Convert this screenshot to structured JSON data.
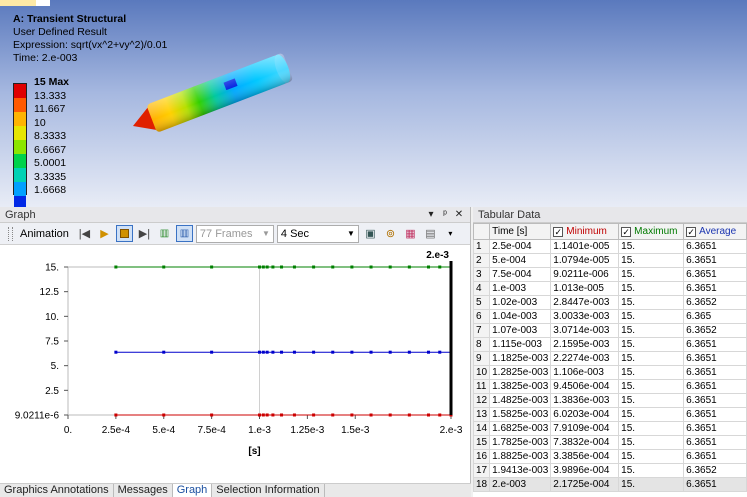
{
  "viewport": {
    "title": "A: Transient Structural",
    "subtitle": "User Defined Result",
    "expression": "Expression: sqrt(vx^2+vy^2)/0.01",
    "time": "Time: 2.e-003",
    "legend": [
      {
        "label": "15 Max",
        "color": "#e00000"
      },
      {
        "label": "13.333",
        "color": "#ff5a00"
      },
      {
        "label": "11.667",
        "color": "#ffb400"
      },
      {
        "label": "10",
        "color": "#e6e600"
      },
      {
        "label": "8.3333",
        "color": "#8ce600"
      },
      {
        "label": "6.6667",
        "color": "#00d24a"
      },
      {
        "label": "5.0001",
        "color": "#00d2b4"
      },
      {
        "label": "3.3335",
        "color": "#00a0ff"
      },
      {
        "label": "1.6668",
        "color": "#0028e6"
      }
    ]
  },
  "graph_panel": {
    "title": "Graph",
    "controls": [
      "▾",
      "ᵖ",
      "✕"
    ],
    "animation_label": "Animation",
    "frames_select": "77 Frames",
    "duration_select": "4 Sec"
  },
  "chart_data": {
    "type": "line",
    "xlabel": "[s]",
    "current_time_label": "2.e-3",
    "xlim": [
      0,
      0.002
    ],
    "ylim": [
      0,
      15
    ],
    "x_ticks": [
      "0.",
      "2.5e-4",
      "5.e-4",
      "7.5e-4",
      "1.e-3",
      "1.25e-3",
      "1.5e-3",
      "2.e-3"
    ],
    "x_tick_values": [
      0,
      0.00025,
      0.0005,
      0.00075,
      0.001,
      0.00125,
      0.0015,
      0.002
    ],
    "y_ticks": [
      "9.0211e-6",
      "2.5",
      "5.",
      "7.5",
      "10.",
      "12.5",
      "15."
    ],
    "y_tick_values": [
      0,
      2.5,
      5,
      7.5,
      10,
      12.5,
      15
    ],
    "x": [
      0.00025,
      0.0005,
      0.00075,
      0.001,
      0.00102,
      0.00104,
      0.00107,
      0.001115,
      0.0011825,
      0.0012825,
      0.0013825,
      0.0014825,
      0.0015825,
      0.0016825,
      0.0017825,
      0.0018825,
      0.0019413,
      0.002
    ],
    "series": [
      {
        "color": "#cc0000",
        "values": [
          1.1401e-05,
          1.0794e-05,
          9.0211e-06,
          1.013e-05,
          0.0028447,
          0.0030033,
          0.0030714,
          0.0021595,
          0.0022274,
          0.001106,
          0.00094506,
          0.0013836,
          0.00060203,
          0.00079109,
          0.00073832,
          0.00033856,
          0.00039896,
          0.00021725
        ]
      },
      {
        "color": "#008000",
        "values": [
          15,
          15,
          15,
          15,
          15,
          15,
          15,
          15,
          15,
          15,
          15,
          15,
          15,
          15,
          15,
          15,
          15,
          15
        ]
      },
      {
        "color": "#0000cc",
        "values": [
          6.3651,
          6.3651,
          6.3651,
          6.3651,
          6.3652,
          6.365,
          6.3652,
          6.3651,
          6.3651,
          6.3651,
          6.3651,
          6.3651,
          6.3651,
          6.3651,
          6.3651,
          6.3651,
          6.3652,
          6.3651
        ]
      }
    ],
    "step_labels": [
      "1",
      "2"
    ]
  },
  "table_panel": {
    "title": "Tabular Data",
    "headers": {
      "time": "Time [s]",
      "min": "Minimum",
      "max": "Maximum",
      "avg": "Average"
    },
    "rows": [
      [
        "1",
        "2.5e-004",
        "1.1401e-005",
        "15.",
        "6.3651"
      ],
      [
        "2",
        "5.e-004",
        "1.0794e-005",
        "15.",
        "6.3651"
      ],
      [
        "3",
        "7.5e-004",
        "9.0211e-006",
        "15.",
        "6.3651"
      ],
      [
        "4",
        "1.e-003",
        "1.013e-005",
        "15.",
        "6.3651"
      ],
      [
        "5",
        "1.02e-003",
        "2.8447e-003",
        "15.",
        "6.3652"
      ],
      [
        "6",
        "1.04e-003",
        "3.0033e-003",
        "15.",
        "6.365"
      ],
      [
        "7",
        "1.07e-003",
        "3.0714e-003",
        "15.",
        "6.3652"
      ],
      [
        "8",
        "1.115e-003",
        "2.1595e-003",
        "15.",
        "6.3651"
      ],
      [
        "9",
        "1.1825e-003",
        "2.2274e-003",
        "15.",
        "6.3651"
      ],
      [
        "10",
        "1.2825e-003",
        "1.106e-003",
        "15.",
        "6.3651"
      ],
      [
        "11",
        "1.3825e-003",
        "9.4506e-004",
        "15.",
        "6.3651"
      ],
      [
        "12",
        "1.4825e-003",
        "1.3836e-003",
        "15.",
        "6.3651"
      ],
      [
        "13",
        "1.5825e-003",
        "6.0203e-004",
        "15.",
        "6.3651"
      ],
      [
        "14",
        "1.6825e-003",
        "7.9109e-004",
        "15.",
        "6.3651"
      ],
      [
        "15",
        "1.7825e-003",
        "7.3832e-004",
        "15.",
        "6.3651"
      ],
      [
        "16",
        "1.8825e-003",
        "3.3856e-004",
        "15.",
        "6.3651"
      ],
      [
        "17",
        "1.9413e-003",
        "3.9896e-004",
        "15.",
        "6.3652"
      ],
      [
        "18",
        "2.e-003",
        "2.1725e-004",
        "15.",
        "6.3651"
      ]
    ]
  },
  "bottom_tabs": [
    "Graphics Annotations",
    "Messages",
    "Graph",
    "Selection Information"
  ],
  "active_tab": "Graph"
}
